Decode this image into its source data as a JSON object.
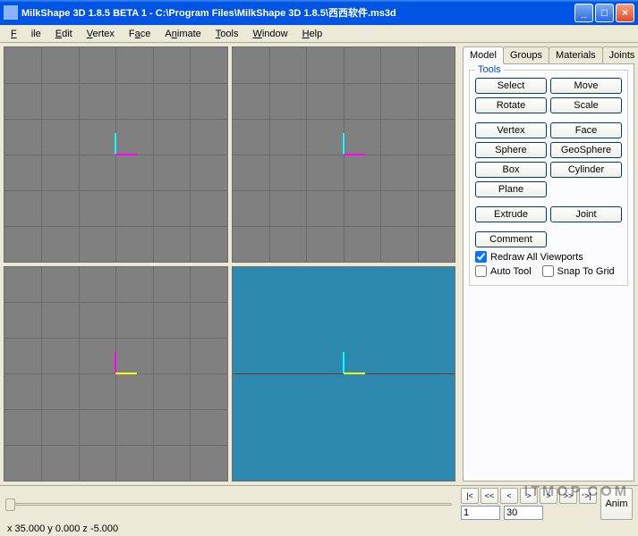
{
  "window": {
    "title": "MilkShape 3D 1.8.5 BETA 1 - C:\\Program Files\\MilkShape 3D 1.8.5\\西西软件.ms3d"
  },
  "menu": {
    "file": "File",
    "edit": "Edit",
    "vertex": "Vertex",
    "face": "Face",
    "animate": "Animate",
    "tools": "Tools",
    "window": "Window",
    "help": "Help"
  },
  "tabs": {
    "model": "Model",
    "groups": "Groups",
    "materials": "Materials",
    "joints": "Joints"
  },
  "tools_group": {
    "title": "Tools",
    "select": "Select",
    "move": "Move",
    "rotate": "Rotate",
    "scale": "Scale",
    "vertex": "Vertex",
    "face": "Face",
    "sphere": "Sphere",
    "geosphere": "GeoSphere",
    "box": "Box",
    "cylinder": "Cylinder",
    "plane": "Plane",
    "extrude": "Extrude",
    "joint": "Joint",
    "comment": "Comment",
    "redraw": "Redraw All Viewports",
    "autotool": "Auto Tool",
    "snap": "Snap To Grid"
  },
  "anim": {
    "btn": "Anim",
    "frame_cur": "1",
    "frame_end": "30"
  },
  "status": {
    "text": "x 35.000 y 0.000 z -5.000"
  },
  "watermark": "ITMOP.COM"
}
